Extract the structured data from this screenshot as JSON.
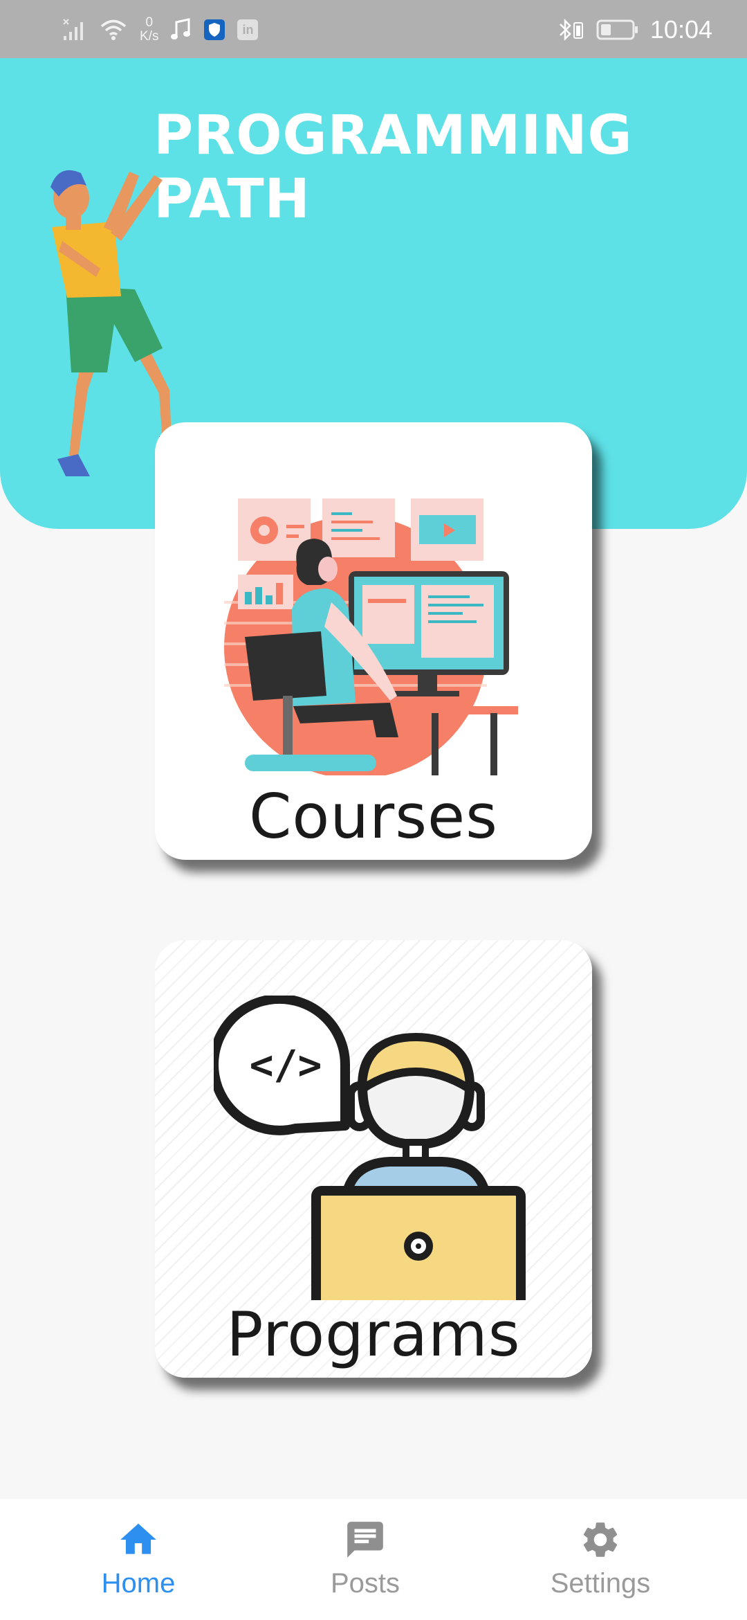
{
  "status_bar": {
    "net_speed_value": "0",
    "net_speed_unit": "K/s",
    "time": "10:04",
    "icons": [
      "signal-icon",
      "wifi-icon",
      "music-icon",
      "shield-app-icon",
      "linkedin-icon",
      "bluetooth-icon",
      "battery-icon"
    ]
  },
  "header": {
    "title_line1": "PROGRAMMING",
    "title_line2": "PATH",
    "bg_color": "#5de0e6"
  },
  "cards": [
    {
      "label": "Courses",
      "image": "developer-at-computer-illustration"
    },
    {
      "label": "Programs",
      "image": "programmer-with-laptop-code-bubble-icon"
    }
  ],
  "bottom_nav": {
    "items": [
      {
        "label": "Home",
        "icon": "home-icon",
        "active": true
      },
      {
        "label": "Posts",
        "icon": "message-icon",
        "active": false
      },
      {
        "label": "Settings",
        "icon": "gear-icon",
        "active": false
      }
    ],
    "active_color": "#2d8ff0",
    "inactive_color": "#9a9a9a"
  }
}
